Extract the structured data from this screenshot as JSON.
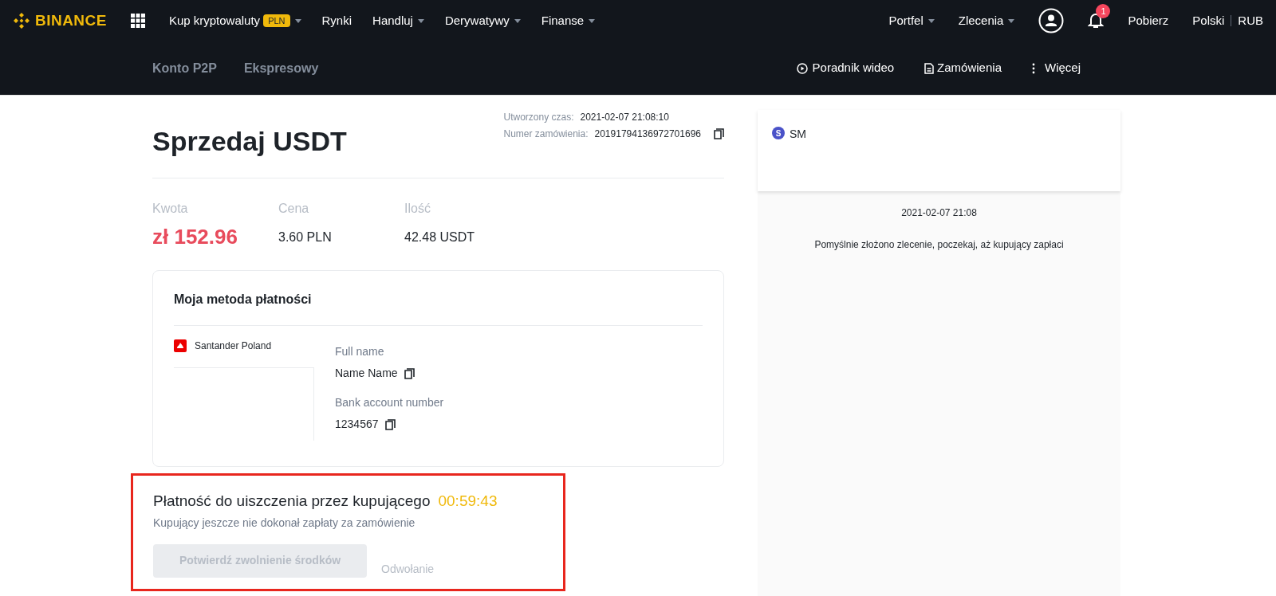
{
  "topbar": {
    "logo": "BINANCE",
    "menu": [
      {
        "label": "Kup kryptowaluty",
        "badge": "PLN",
        "dropdown": true
      },
      {
        "label": "Rynki",
        "dropdown": false
      },
      {
        "label": "Handluj",
        "dropdown": true
      },
      {
        "label": "Derywatywy",
        "dropdown": true
      },
      {
        "label": "Finanse",
        "dropdown": true
      }
    ],
    "right_menu": [
      {
        "label": "Portfel",
        "dropdown": true
      },
      {
        "label": "Zlecenia",
        "dropdown": true
      }
    ],
    "notifications": "1",
    "download": "Pobierz",
    "language": "Polski",
    "currency": "RUB"
  },
  "subnav": {
    "tabs": [
      {
        "label": "Konto P2P"
      },
      {
        "label": "Ekspresowy"
      }
    ],
    "actions": [
      {
        "kind": "video",
        "label": "Poradnik wideo"
      },
      {
        "kind": "orders",
        "label": "Zamówienia"
      },
      {
        "kind": "more",
        "label": "Więcej"
      }
    ]
  },
  "order": {
    "title": "Sprzedaj USDT",
    "meta": [
      {
        "label": "Utworzony czas:",
        "value": "2021-02-07 21:08:10",
        "copy": false
      },
      {
        "label": "Numer zamówienia:",
        "value": "20191794136972701696",
        "copy": true
      }
    ],
    "stats": [
      {
        "label": "Kwota",
        "value": "zł 152.96",
        "highlight": true
      },
      {
        "label": "Cena",
        "value": "3.60 PLN",
        "highlight": false
      },
      {
        "label": "Ilość",
        "value": "42.48 USDT",
        "highlight": false
      }
    ],
    "payment_method": {
      "title": "Moja metoda płatności",
      "bank": "Santander Poland",
      "fields": [
        {
          "label": "Full name",
          "value": "Name Name"
        },
        {
          "label": "Bank account number",
          "value": "1234567"
        }
      ]
    },
    "status": {
      "highlighted": true,
      "title": "Płatność do uiszczenia przez kupującego",
      "timer": "00:59:43",
      "subtitle": "Kupujący jeszcze nie dokonał zapłaty za zamówienie",
      "confirm": {
        "label": "Potwierdź zwolnienie środków",
        "disabled": true
      },
      "appeal": {
        "label": "Odwołanie",
        "disabled": true
      }
    }
  },
  "chat": {
    "initial": "S",
    "name": "SM",
    "messages": [
      {
        "time": "2021-02-07 21:08",
        "text": "Pomyślnie złożono zlecenie, poczekaj, aż kupujący zapłaci"
      }
    ]
  }
}
